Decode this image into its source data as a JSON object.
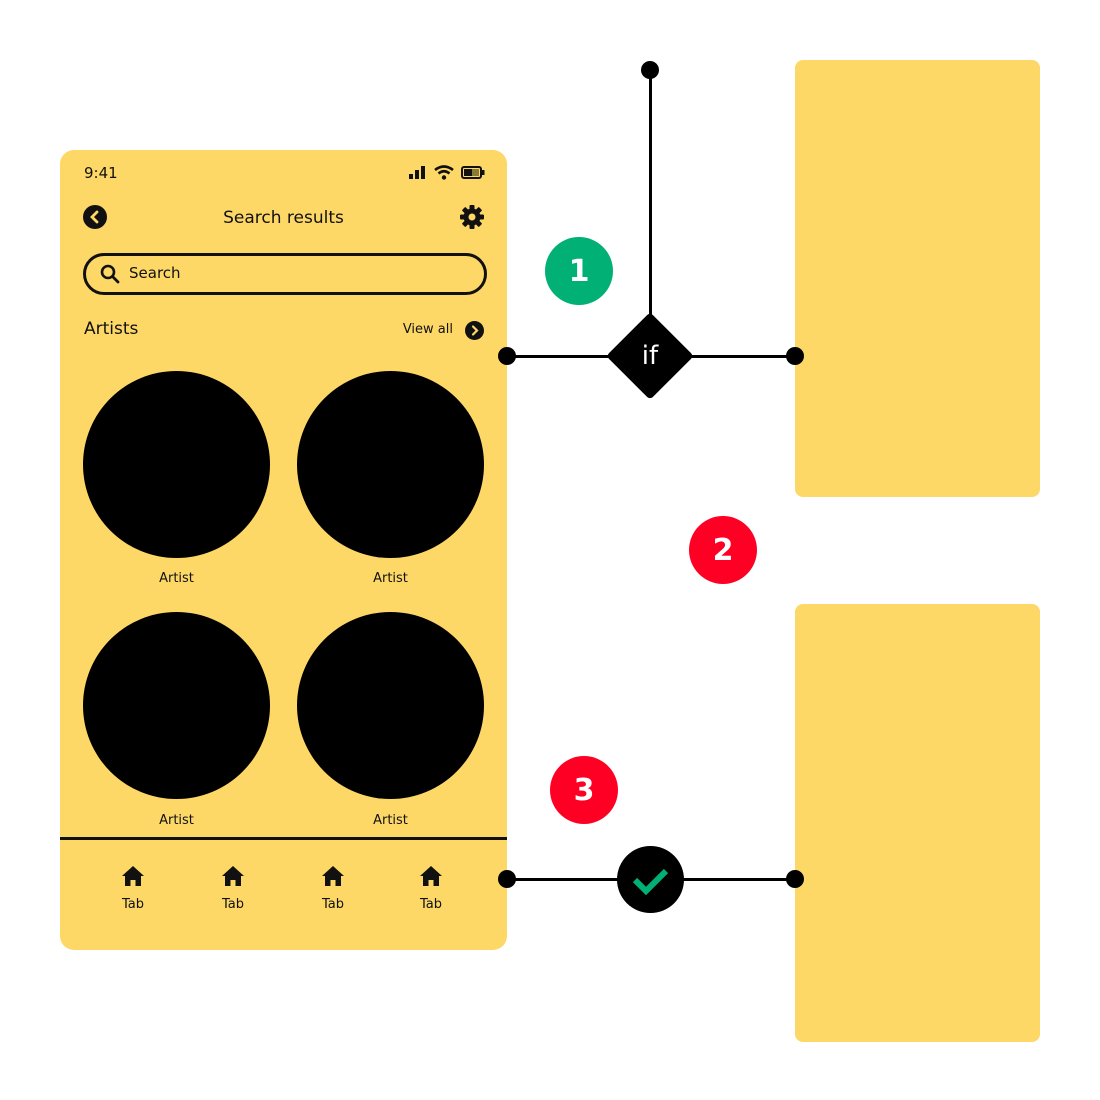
{
  "colors": {
    "panel": "#FDD867",
    "success": "#00B074",
    "error": "#FF0025",
    "ink": "#111111"
  },
  "phone": {
    "status": {
      "time": "9:41",
      "icons": [
        "signal-icon",
        "wifi-icon",
        "battery-icon"
      ]
    },
    "header": {
      "title": "Search results",
      "back_icon": "chevron-left-icon",
      "settings_icon": "gear-icon"
    },
    "search": {
      "placeholder": "Search",
      "value": ""
    },
    "section": {
      "title": "Artists",
      "view_all": "View all"
    },
    "artists": [
      {
        "label": "Artist"
      },
      {
        "label": "Artist"
      },
      {
        "label": "Artist"
      },
      {
        "label": "Artist"
      }
    ],
    "tabs": [
      {
        "label": "Tab",
        "icon": "home-icon"
      },
      {
        "label": "Tab",
        "icon": "home-icon"
      },
      {
        "label": "Tab",
        "icon": "home-icon"
      },
      {
        "label": "Tab",
        "icon": "home-icon"
      }
    ]
  },
  "flow": {
    "decision_label": "if",
    "badges": [
      {
        "number": "1",
        "status": "success"
      },
      {
        "number": "2",
        "status": "error"
      },
      {
        "number": "3",
        "status": "error"
      }
    ],
    "check_icon": "check-icon"
  }
}
